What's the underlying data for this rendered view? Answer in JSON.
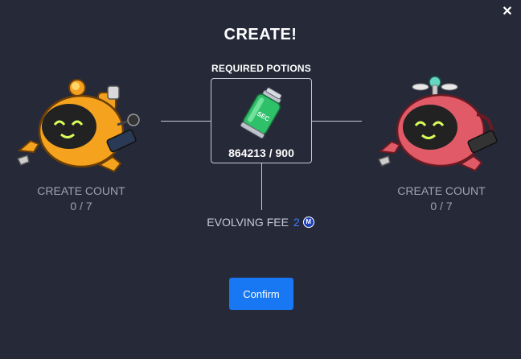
{
  "dialog": {
    "title": "CREATE!",
    "close_icon": "close-icon"
  },
  "potions": {
    "label": "REQUIRED POTIONS",
    "count": "864213 / 900",
    "icon": "potion-canister-icon",
    "canister_text": "SEC"
  },
  "left_robot": {
    "count_label": "CREATE COUNT",
    "count_value": "0 / 7",
    "color": "#f0a020"
  },
  "right_robot": {
    "count_label": "CREATE COUNT",
    "count_value": "0 / 7",
    "color": "#e05a68"
  },
  "fee": {
    "label": "EVOLVING FEE",
    "amount": "2",
    "icon": "token-coin-icon"
  },
  "confirm": {
    "label": "Confirm"
  },
  "colors": {
    "background": "#262938",
    "accent": "#1877f2",
    "line": "#c8cbd6",
    "muted_text": "#9ea3b3"
  }
}
